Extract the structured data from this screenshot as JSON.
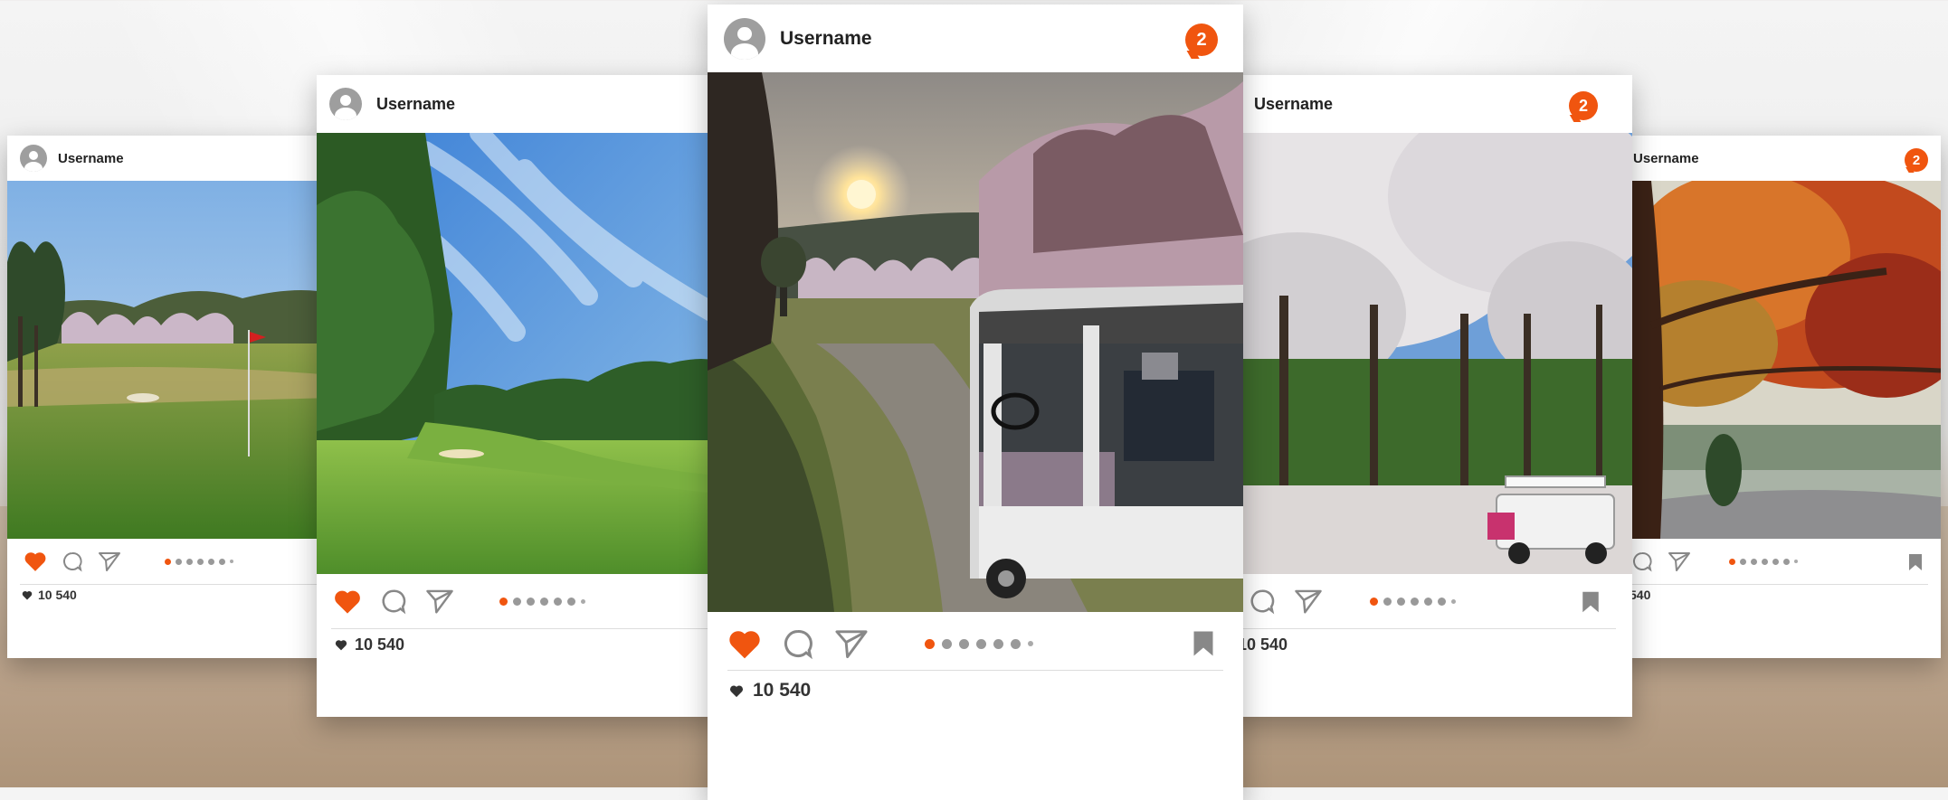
{
  "brand": {
    "accent": "#f0550f",
    "icon_gray": "#888888"
  },
  "posts": [
    {
      "username": "Username",
      "likes": "10 540",
      "carousel": {
        "total": 7,
        "active": 1
      }
    },
    {
      "username": "Username",
      "likes": "10 540",
      "carousel": {
        "total": 7,
        "active": 1
      }
    },
    {
      "username": "Username",
      "likes": "10 540",
      "notifications": "2",
      "carousel": {
        "total": 7,
        "active": 1
      }
    },
    {
      "username": "Username",
      "likes": "10 540",
      "notifications": "2",
      "carousel": {
        "total": 7,
        "active": 1
      }
    },
    {
      "username": "Username",
      "likes": "540",
      "notifications": "2",
      "carousel": {
        "total": 7,
        "active": 1
      }
    }
  ],
  "icons": [
    "avatar-icon",
    "heart-icon",
    "comment-icon",
    "send-icon",
    "bookmark-icon",
    "small-heart-icon"
  ]
}
